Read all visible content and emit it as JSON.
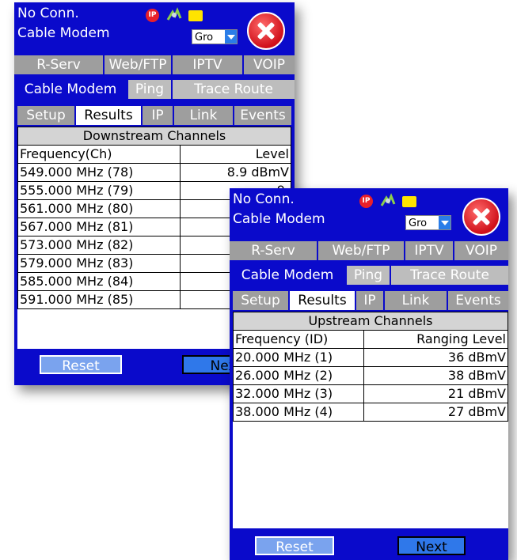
{
  "accent_color": "#0a0acb",
  "screens": [
    {
      "status": {
        "connection": "No Conn.",
        "mode": "Cable Modem",
        "group": "Gro",
        "ip_badge": "IP"
      },
      "tabs_row1": [
        "R-Serv",
        "Web/FTP",
        "IPTV",
        "VOIP"
      ],
      "tabs_row2": [
        "Cable Modem",
        "Ping",
        "Trace Route"
      ],
      "tabs_row3": [
        "Setup",
        "Results",
        "IP",
        "Link",
        "Events"
      ],
      "table": {
        "caption": "Downstream Channels",
        "col1": "Frequency(Ch)",
        "col2": "Level",
        "rows": [
          {
            "freq": "549.000 MHz (78)",
            "level": "8.9 dBmV"
          },
          {
            "freq": "555.000 MHz (79)",
            "level": "9."
          },
          {
            "freq": "561.000 MHz (80)",
            "level": "9."
          },
          {
            "freq": "567.000 MHz (81)",
            "level": "9."
          },
          {
            "freq": "573.000 MHz (82)",
            "level": "9."
          },
          {
            "freq": "579.000 MHz (83)",
            "level": "9."
          },
          {
            "freq": "585.000 MHz (84)",
            "level": "10."
          },
          {
            "freq": "591.000 MHz (85)",
            "level": "10."
          }
        ]
      },
      "buttons": {
        "reset": "Reset",
        "next": "Nex"
      }
    },
    {
      "status": {
        "connection": "No Conn.",
        "mode": "Cable Modem",
        "group": "Gro",
        "ip_badge": "IP"
      },
      "tabs_row1": [
        "R-Serv",
        "Web/FTP",
        "IPTV",
        "VOIP"
      ],
      "tabs_row2": [
        "Cable Modem",
        "Ping",
        "Trace Route"
      ],
      "tabs_row3": [
        "Setup",
        "Results",
        "IP",
        "Link",
        "Events"
      ],
      "table": {
        "caption": "Upstream Channels",
        "col1": "Frequency (ID)",
        "col2": "Ranging Level",
        "rows": [
          {
            "freq": "20.000 MHz (1)",
            "level": "36 dBmV"
          },
          {
            "freq": "26.000 MHz (2)",
            "level": "38 dBmV"
          },
          {
            "freq": "32.000 MHz (3)",
            "level": "21 dBmV"
          },
          {
            "freq": "38.000 MHz (4)",
            "level": "27 dBmV"
          }
        ]
      },
      "buttons": {
        "reset": "Reset",
        "next": "Next"
      }
    }
  ]
}
